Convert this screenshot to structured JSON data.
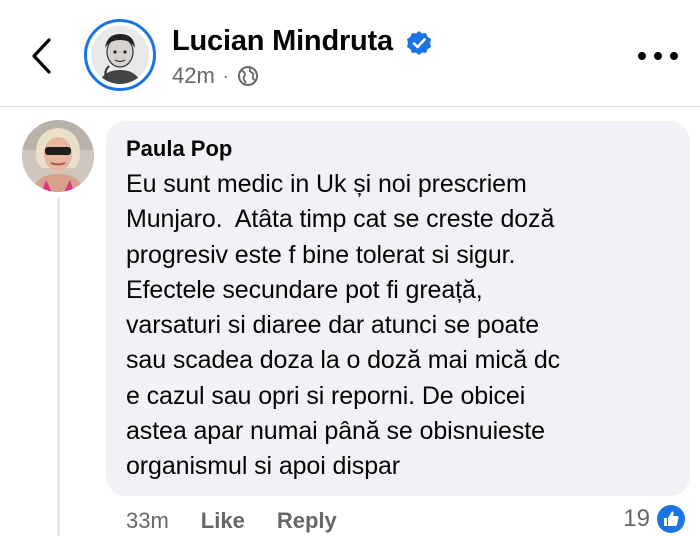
{
  "header": {
    "author_name": "Lucian Mindruta",
    "post_time": "42m",
    "separator": "·"
  },
  "comment": {
    "author_name": "Paula Pop",
    "text": "Eu sunt medic in Uk și noi prescriem\nMunjaro.  Atâta timp cat se creste doză\nprogresiv este f bine tolerat si sigur.\nEfectele secundare pot fi greață,\nvarsaturi si diaree dar atunci se poate\nsau scadea doza la o doză mai mică dc\ne cazul sau opri si reporni. De obicei\nastea apar numai până se obisnuieste\norganismul si apoi dispar",
    "time": "33m",
    "like_label": "Like",
    "reply_label": "Reply",
    "reaction_count": "19"
  },
  "colors": {
    "accent": "#1b74e4",
    "bubble": "#f0f2f5",
    "secondary_text": "#65676b"
  },
  "icons": {
    "back": "chevron-left-icon",
    "verified": "verified-badge-icon",
    "privacy": "globe-icon",
    "more": "more-dots-icon",
    "reaction": "like-thumb-icon"
  }
}
